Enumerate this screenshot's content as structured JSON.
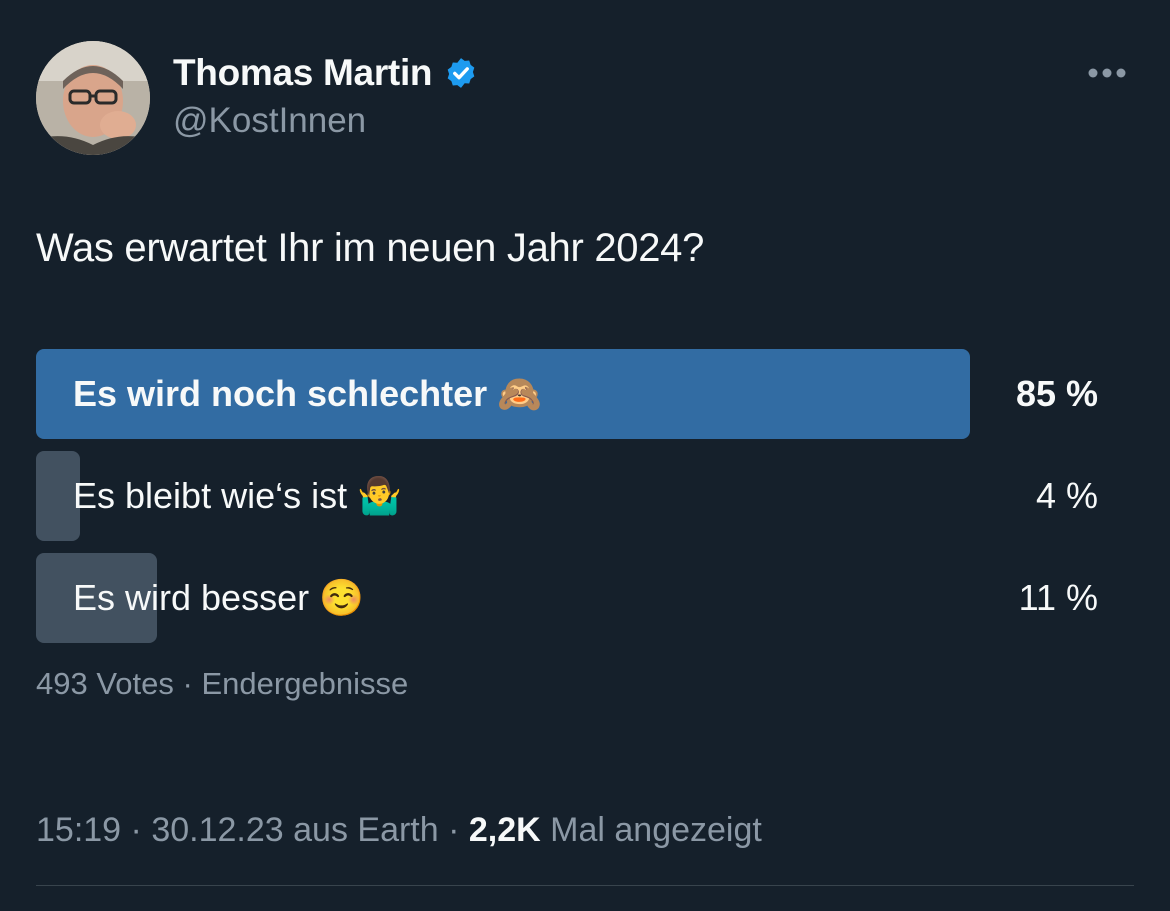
{
  "author": {
    "name": "Thomas Martin",
    "handle": "@KostInnen",
    "verified": true,
    "avatar_icon": "person-photo"
  },
  "more_icon": "more-horizontal-icon",
  "tweet": {
    "text": "Was erwartet Ihr im neuen Jahr 2024?"
  },
  "poll": {
    "options": [
      {
        "label": "Es wird noch schlechter 🙈",
        "percent_label": "85 %",
        "percent": 85,
        "winner": true
      },
      {
        "label": "Es bleibt wie‘s ist 🤷‍♂️",
        "percent_label": "4 %",
        "percent": 4,
        "winner": false
      },
      {
        "label": "Es wird besser ☺️",
        "percent_label": "11 %",
        "percent": 11,
        "winner": false
      }
    ],
    "votes": "493 Votes",
    "status": "Endergebnisse",
    "sep": " · "
  },
  "footer": {
    "time": "15:19",
    "date": "30.12.23",
    "source": "aus Earth",
    "views_count": "2,2K",
    "views_label": "Mal angezeigt",
    "sep": " · "
  },
  "colors": {
    "background": "#15202b",
    "winner_bar": "#326ca3",
    "other_bar": "#425160",
    "verified": "#1d9bf0",
    "secondary_text": "#8b98a5"
  }
}
